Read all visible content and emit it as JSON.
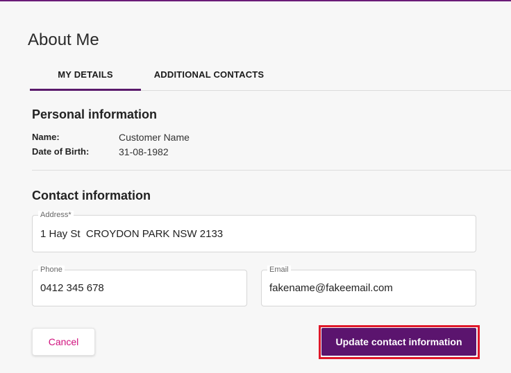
{
  "page": {
    "title": "About Me"
  },
  "tabs": [
    {
      "label": "MY DETAILS",
      "active": true
    },
    {
      "label": "ADDITIONAL CONTACTS",
      "active": false
    }
  ],
  "personal": {
    "title": "Personal information",
    "name_label": "Name:",
    "name_value": "Customer Name",
    "dob_label": "Date of Birth:",
    "dob_value": "31-08-1982"
  },
  "contact": {
    "title": "Contact information",
    "address_label": "Address*",
    "address_value": "1 Hay St  CROYDON PARK NSW 2133",
    "phone_label": "Phone",
    "phone_value": "0412 345 678",
    "email_label": "Email",
    "email_value": "fakename@fakeemail.com"
  },
  "actions": {
    "cancel_label": "Cancel",
    "update_label": "Update contact information"
  },
  "colors": {
    "accent": "#5b146e",
    "cancel_text": "#d0117d",
    "highlight": "#e0182a"
  }
}
